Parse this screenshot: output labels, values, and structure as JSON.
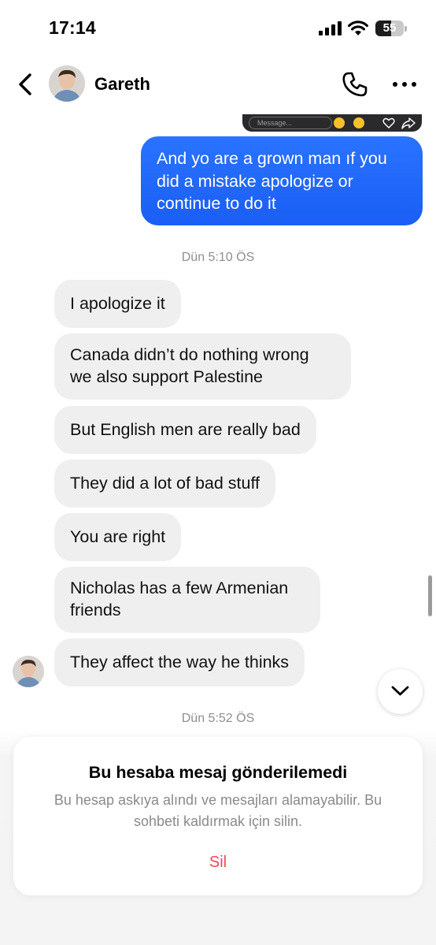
{
  "status_bar": {
    "time": "17:14",
    "battery": "55",
    "battery_percent": 55
  },
  "header": {
    "contact_name": "Gareth"
  },
  "story_reply": {
    "placeholder": "Message..."
  },
  "messages": {
    "outgoing": "And yo are a grown man ıf you did a mistake apologize or continue to do it",
    "timestamp_1": "Dün 5:10 ÖS",
    "incoming": [
      "I apologize it",
      "Canada didn’t do nothing wrong we also support Palestine",
      "But English men are really bad",
      "They did a lot of bad stuff",
      "You are right",
      "Nicholas has a few Armenian friends",
      "They affect the way he thinks"
    ],
    "timestamp_2": "Dün 5:52 ÖS"
  },
  "notice": {
    "title": "Bu hesaba mesaj gönderilemedi",
    "body": "Bu hesap askıya alındı ve mesajları alamayabilir. Bu sohbeti kaldırmak için silin.",
    "delete_label": "Sil"
  },
  "colors": {
    "outgoing_bubble": "#1f66fa",
    "incoming_bubble": "#efefef",
    "delete_text": "#ed4956"
  }
}
